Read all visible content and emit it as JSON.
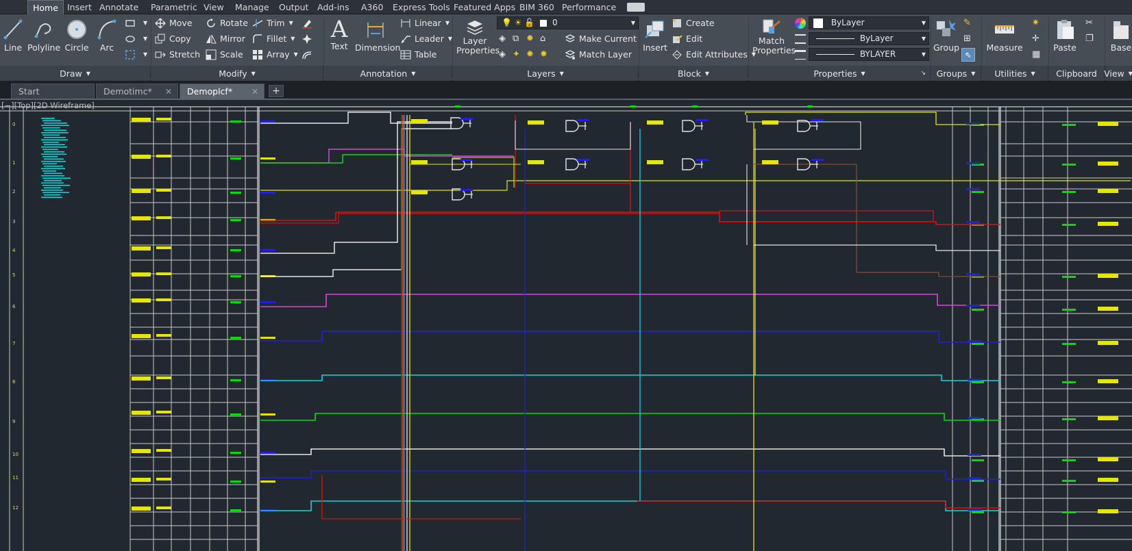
{
  "ribbon_tabs": [
    {
      "label": "Home",
      "active": true
    },
    {
      "label": "Insert"
    },
    {
      "label": "Annotate"
    },
    {
      "label": "Parametric"
    },
    {
      "label": "View"
    },
    {
      "label": "Manage"
    },
    {
      "label": "Output"
    },
    {
      "label": "Add-ins"
    },
    {
      "label": "A360"
    },
    {
      "label": "Express Tools"
    },
    {
      "label": "Featured Apps"
    },
    {
      "label": "BIM 360"
    },
    {
      "label": "Performance"
    }
  ],
  "draw": {
    "line": "Line",
    "polyline": "Polyline",
    "circle": "Circle",
    "arc": "Arc",
    "panel": "Draw"
  },
  "modify": {
    "move": "Move",
    "rotate": "Rotate",
    "trim": "Trim",
    "copy": "Copy",
    "mirror": "Mirror",
    "fillet": "Fillet",
    "stretch": "Stretch",
    "scale": "Scale",
    "array": "Array",
    "panel": "Modify"
  },
  "annotation": {
    "text": "Text",
    "dimension": "Dimension",
    "linear": "Linear",
    "leader": "Leader",
    "table": "Table",
    "panel": "Annotation"
  },
  "layers": {
    "layer_properties_1": "Layer",
    "layer_properties_2": "Properties",
    "current_layer": "0",
    "make_current": "Make Current",
    "match_layer": "Match Layer",
    "panel": "Layers"
  },
  "block": {
    "insert": "Insert",
    "create": "Create",
    "edit": "Edit",
    "edit_attributes": "Edit Attributes",
    "panel": "Block"
  },
  "properties": {
    "match_1": "Match",
    "match_2": "Properties",
    "color": "ByLayer",
    "linetype": "ByLayer",
    "lineweight": "BYLAYER",
    "panel": "Properties"
  },
  "groups": {
    "group": "Group",
    "panel": "Groups"
  },
  "utilities": {
    "measure": "Measure",
    "panel": "Utilities"
  },
  "clipboard": {
    "paste": "Paste",
    "panel": "Clipboard"
  },
  "view_panel": {
    "base": "Base",
    "panel": "View"
  },
  "doc_tabs": [
    {
      "label": "Start"
    },
    {
      "label": "Demotimc*"
    },
    {
      "label": "Demoplcf*",
      "active": true
    }
  ],
  "viewport_label": "[−][Top][2D Wireframe]",
  "rung_numbers": [
    "0",
    "1",
    "2",
    "3",
    "4",
    "5",
    "6",
    "7",
    "8",
    "9",
    "10",
    "11",
    "12"
  ],
  "colors": {
    "ribbon": "#474d55",
    "canvas": "#212830",
    "wire_yellow": "#e6e600",
    "wire_red": "#e01010",
    "wire_cyan": "#00dcdc",
    "wire_green": "#00e000",
    "wire_magenta": "#e040e0",
    "wire_blue": "#2020e0",
    "wire_white": "#e6e6e6",
    "wire_brown": "#8a4a30"
  }
}
